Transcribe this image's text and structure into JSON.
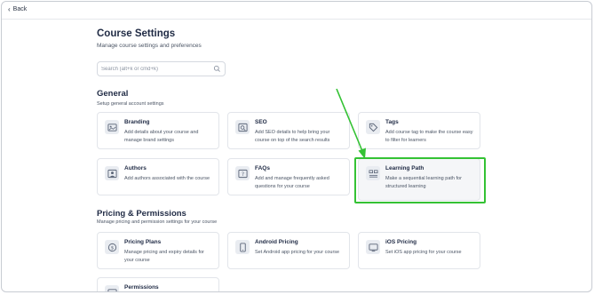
{
  "nav": {
    "back_label": "Back"
  },
  "header": {
    "title": "Course Settings",
    "subtitle": "Manage course settings and preferences"
  },
  "search": {
    "placeholder": "Search (alt+k or cmd+k)",
    "value": ""
  },
  "general": {
    "title": "General",
    "subtitle": "Setup general account settings",
    "cards": [
      {
        "title": "Branding",
        "description": "Add details about your course and manage brand settings",
        "icon": "branding-icon"
      },
      {
        "title": "SEO",
        "description": "Add SEO details to help bring your course on top of the search results",
        "icon": "seo-icon"
      },
      {
        "title": "Tags",
        "description": "Add course tag to make the course easy to filter for learners",
        "icon": "tag-icon"
      },
      {
        "title": "Authors",
        "description": "Add authors associated with the course",
        "icon": "authors-icon"
      },
      {
        "title": "FAQs",
        "description": "Add and manage frequently asked questions for your course",
        "icon": "faq-icon"
      },
      {
        "title": "Learning Path",
        "description": "Make a sequential learning path for structured learning",
        "icon": "learning-path-icon"
      }
    ]
  },
  "pricing": {
    "title": "Pricing & Permissions",
    "subtitle": "Manage pricing and permission settings for your course",
    "cards": [
      {
        "title": "Pricing Plans",
        "description": "Manage pricing and expiry details for your course",
        "icon": "pricing-plans-icon"
      },
      {
        "title": "Android Pricing",
        "description": "Set Android app pricing for your course",
        "icon": "android-icon"
      },
      {
        "title": "iOS Pricing",
        "description": "Set iOS app pricing for your course",
        "icon": "ios-icon"
      },
      {
        "title": "Permissions",
        "description": "",
        "icon": "permissions-icon"
      }
    ]
  },
  "colors": {
    "highlight": "#34c234",
    "card_border": "#e2e5ea",
    "text": "#1f2a44",
    "muted": "#4b5565"
  }
}
